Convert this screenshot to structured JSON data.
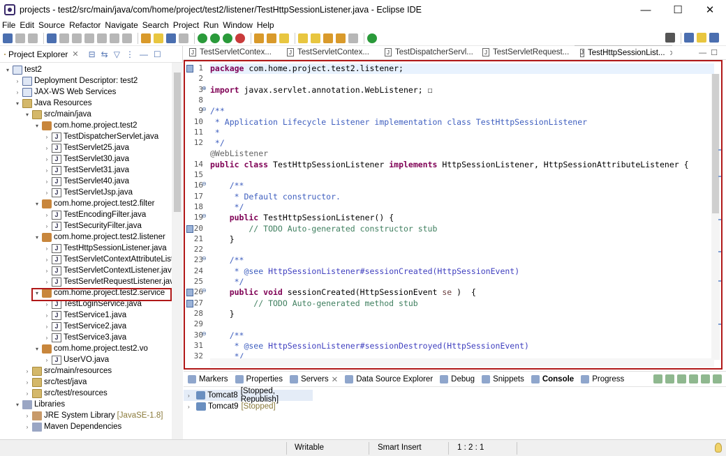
{
  "window": {
    "title": "projects - test2/src/main/java/com/home/project/test2/listener/TestHttpSessionListener.java - Eclipse IDE",
    "minimize": "—",
    "maximize": "☐",
    "close": "✕"
  },
  "menu": [
    "File",
    "Edit",
    "Source",
    "Refactor",
    "Navigate",
    "Search",
    "Project",
    "Run",
    "Window",
    "Help"
  ],
  "explorer": {
    "title": "Project Explorer",
    "close": "✕",
    "tree": [
      {
        "label": "test2",
        "icon": "project-icon",
        "indent": 0,
        "twisty": "▾"
      },
      {
        "label": "Deployment Descriptor: test2",
        "icon": "descriptor-icon",
        "indent": 1,
        "twisty": "›"
      },
      {
        "label": "JAX-WS Web Services",
        "icon": "webservices-icon",
        "indent": 1,
        "twisty": "›"
      },
      {
        "label": "Java Resources",
        "icon": "folder-icon",
        "indent": 1,
        "twisty": "▾"
      },
      {
        "label": "src/main/java",
        "icon": "folder-icon",
        "indent": 2,
        "twisty": "▾"
      },
      {
        "label": "com.home.project.test2",
        "icon": "package-icon",
        "indent": 3,
        "twisty": "▾"
      },
      {
        "label": "TestDispatcherServlet.java",
        "icon": "java-file-icon",
        "indent": 4,
        "twisty": "›"
      },
      {
        "label": "TestServlet25.java",
        "icon": "java-file-icon",
        "indent": 4,
        "twisty": "›"
      },
      {
        "label": "TestServlet30.java",
        "icon": "java-file-icon",
        "indent": 4,
        "twisty": "›"
      },
      {
        "label": "TestServlet31.java",
        "icon": "java-file-icon",
        "indent": 4,
        "twisty": "›"
      },
      {
        "label": "TestServlet40.java",
        "icon": "java-file-icon",
        "indent": 4,
        "twisty": "›"
      },
      {
        "label": "TestServletJsp.java",
        "icon": "java-file-icon",
        "indent": 4,
        "twisty": "›"
      },
      {
        "label": "com.home.project.test2.filter",
        "icon": "package-icon",
        "indent": 3,
        "twisty": "▾"
      },
      {
        "label": "TestEncodingFilter.java",
        "icon": "java-file-icon",
        "indent": 4,
        "twisty": "›"
      },
      {
        "label": "TestSecurityFilter.java",
        "icon": "java-file-icon",
        "indent": 4,
        "twisty": "›"
      },
      {
        "label": "com.home.project.test2.listener",
        "icon": "package-icon",
        "indent": 3,
        "twisty": "▾"
      },
      {
        "label": "TestHttpSessionListener.java",
        "icon": "java-file-icon",
        "indent": 4,
        "twisty": "›",
        "selected": true
      },
      {
        "label": "TestServletContextAttributeListe",
        "icon": "java-file-icon",
        "indent": 4,
        "twisty": "›"
      },
      {
        "label": "TestServletContextListener.java",
        "icon": "java-file-icon",
        "indent": 4,
        "twisty": "›"
      },
      {
        "label": "TestServletRequestListener.java",
        "icon": "java-file-icon",
        "indent": 4,
        "twisty": "›"
      },
      {
        "label": "com.home.project.test2.service",
        "icon": "package-icon",
        "indent": 3,
        "twisty": "▾"
      },
      {
        "label": "TestLoginService.java",
        "icon": "java-file-icon",
        "indent": 4,
        "twisty": "›"
      },
      {
        "label": "TestService1.java",
        "icon": "java-file-icon",
        "indent": 4,
        "twisty": "›"
      },
      {
        "label": "TestService2.java",
        "icon": "java-file-icon",
        "indent": 4,
        "twisty": "›"
      },
      {
        "label": "TestService3.java",
        "icon": "java-file-icon",
        "indent": 4,
        "twisty": "›"
      },
      {
        "label": "com.home.project.test2.vo",
        "icon": "package-icon",
        "indent": 3,
        "twisty": "▾"
      },
      {
        "label": "UserVO.java",
        "icon": "java-file-icon",
        "indent": 4,
        "twisty": "›"
      },
      {
        "label": "src/main/resources",
        "icon": "folder-icon",
        "indent": 2,
        "twisty": "›"
      },
      {
        "label": "src/test/java",
        "icon": "folder-icon",
        "indent": 2,
        "twisty": "›"
      },
      {
        "label": "src/test/resources",
        "icon": "folder-icon",
        "indent": 2,
        "twisty": "›"
      },
      {
        "label": "Libraries",
        "icon": "library-icon",
        "indent": 1,
        "twisty": "▾"
      },
      {
        "label": "JRE System Library",
        "tag": "[JavaSE-1.8]",
        "icon": "jre-icon",
        "indent": 2,
        "twisty": "›"
      },
      {
        "label": "Maven Dependencies",
        "icon": "library-icon",
        "indent": 2,
        "twisty": "›"
      }
    ]
  },
  "editor_tabs": [
    {
      "label": "TestServletContex...",
      "active": false
    },
    {
      "label": "TestServletContex...",
      "active": false
    },
    {
      "label": "TestDispatcherServl...",
      "active": false
    },
    {
      "label": "TestServletRequest...",
      "active": false
    },
    {
      "label": "TestHttpSessionList...",
      "active": true
    }
  ],
  "code": [
    {
      "n": "1",
      "fold": "",
      "marker": true,
      "hl": true,
      "parts": [
        [
          "kw",
          "package"
        ],
        [
          "",
          "com.home.project.test2.listener;"
        ]
      ],
      "sep": " "
    },
    {
      "n": "2",
      "parts": []
    },
    {
      "n": "3",
      "fold": "⊕",
      "parts": [
        [
          "kw",
          "import"
        ],
        [
          "",
          "javax.servlet.annotation.WebListener;"
        ],
        [
          "",
          "☐"
        ]
      ]
    },
    {
      "n": "8",
      "parts": []
    },
    {
      "n": "9",
      "fold": "⊖",
      "parts": [
        [
          "cm",
          "/**"
        ]
      ]
    },
    {
      "n": "10",
      "parts": [
        [
          "cm",
          " * Application Lifecycle Listener implementation class TestHttpSessionListener"
        ]
      ]
    },
    {
      "n": "11",
      "parts": [
        [
          "cm",
          " *"
        ]
      ]
    },
    {
      "n": "12",
      "parts": [
        [
          "cm",
          " */"
        ]
      ]
    },
    {
      "n": "",
      "parts": [
        [
          "an",
          "@WebListener"
        ]
      ]
    },
    {
      "n": "14",
      "parts": [
        [
          "kw",
          "public class"
        ],
        [
          "",
          "TestHttpSessionListener"
        ],
        [
          "kw",
          "implements"
        ],
        [
          "",
          "HttpSessionListener, HttpSessionAttributeListener {"
        ]
      ]
    },
    {
      "n": "15",
      "parts": []
    },
    {
      "n": "16",
      "fold": "⊖",
      "parts": [
        [
          "cm",
          "    /**"
        ]
      ]
    },
    {
      "n": "17",
      "parts": [
        [
          "cm",
          "     * Default constructor."
        ]
      ]
    },
    {
      "n": "18",
      "parts": [
        [
          "cm",
          "     */"
        ]
      ]
    },
    {
      "n": "19",
      "fold": "⊖",
      "parts": [
        [
          "kw",
          "    public"
        ],
        [
          "",
          "TestHttpSessionListener() {"
        ]
      ]
    },
    {
      "n": "20",
      "task": true,
      "parts": [
        [
          "tc",
          "        // TODO Auto-generated constructor stub"
        ]
      ]
    },
    {
      "n": "21",
      "parts": [
        [
          "",
          "    }"
        ]
      ]
    },
    {
      "n": "22",
      "parts": []
    },
    {
      "n": "23",
      "fold": "⊖",
      "parts": [
        [
          "cm",
          "    /**"
        ]
      ]
    },
    {
      "n": "24",
      "parts": [
        [
          "cm",
          "     * @see"
        ],
        [
          "lnk",
          "HttpSessionListener#sessionCreated(HttpSessionEvent)"
        ]
      ]
    },
    {
      "n": "25",
      "parts": [
        [
          "cm",
          "     */"
        ]
      ]
    },
    {
      "n": "26",
      "fold": "⊖",
      "override": true,
      "parts": [
        [
          "kw",
          "    public void"
        ],
        [
          "",
          "sessionCreated(HttpSessionEvent"
        ],
        [
          "pm",
          "se"
        ],
        [
          "",
          ")  {"
        ]
      ]
    },
    {
      "n": "27",
      "task": true,
      "parts": [
        [
          "tc",
          "         // TODO Auto-generated method stub"
        ]
      ]
    },
    {
      "n": "28",
      "parts": [
        [
          "",
          "    }"
        ]
      ]
    },
    {
      "n": "29",
      "parts": []
    },
    {
      "n": "30",
      "fold": "⊖",
      "parts": [
        [
          "cm",
          "    /**"
        ]
      ]
    },
    {
      "n": "31",
      "parts": [
        [
          "cm",
          "     * @see"
        ],
        [
          "lnk",
          "HttpSessionListener#sessionDestroyed(HttpSessionEvent)"
        ]
      ]
    },
    {
      "n": "32",
      "parts": [
        [
          "cm",
          "     */"
        ]
      ]
    }
  ],
  "bottom_tabs": [
    {
      "label": "Markers",
      "active": false
    },
    {
      "label": "Properties",
      "active": false
    },
    {
      "label": "Servers",
      "active": false,
      "close": "✕"
    },
    {
      "label": "Data Source Explorer",
      "active": false
    },
    {
      "label": "Debug",
      "active": false
    },
    {
      "label": "Snippets",
      "active": false
    },
    {
      "label": "Console",
      "active": true
    },
    {
      "label": "Progress",
      "active": false
    }
  ],
  "servers": [
    {
      "name": "Tomcat8",
      "status": "[Stopped, Republish]",
      "selected": true
    },
    {
      "name": "Tomcat9",
      "status": "[Stopped]",
      "selected": false
    }
  ],
  "status": {
    "writable": "Writable",
    "insert_mode": "Smart Insert",
    "position": "1 : 2 : 1"
  }
}
